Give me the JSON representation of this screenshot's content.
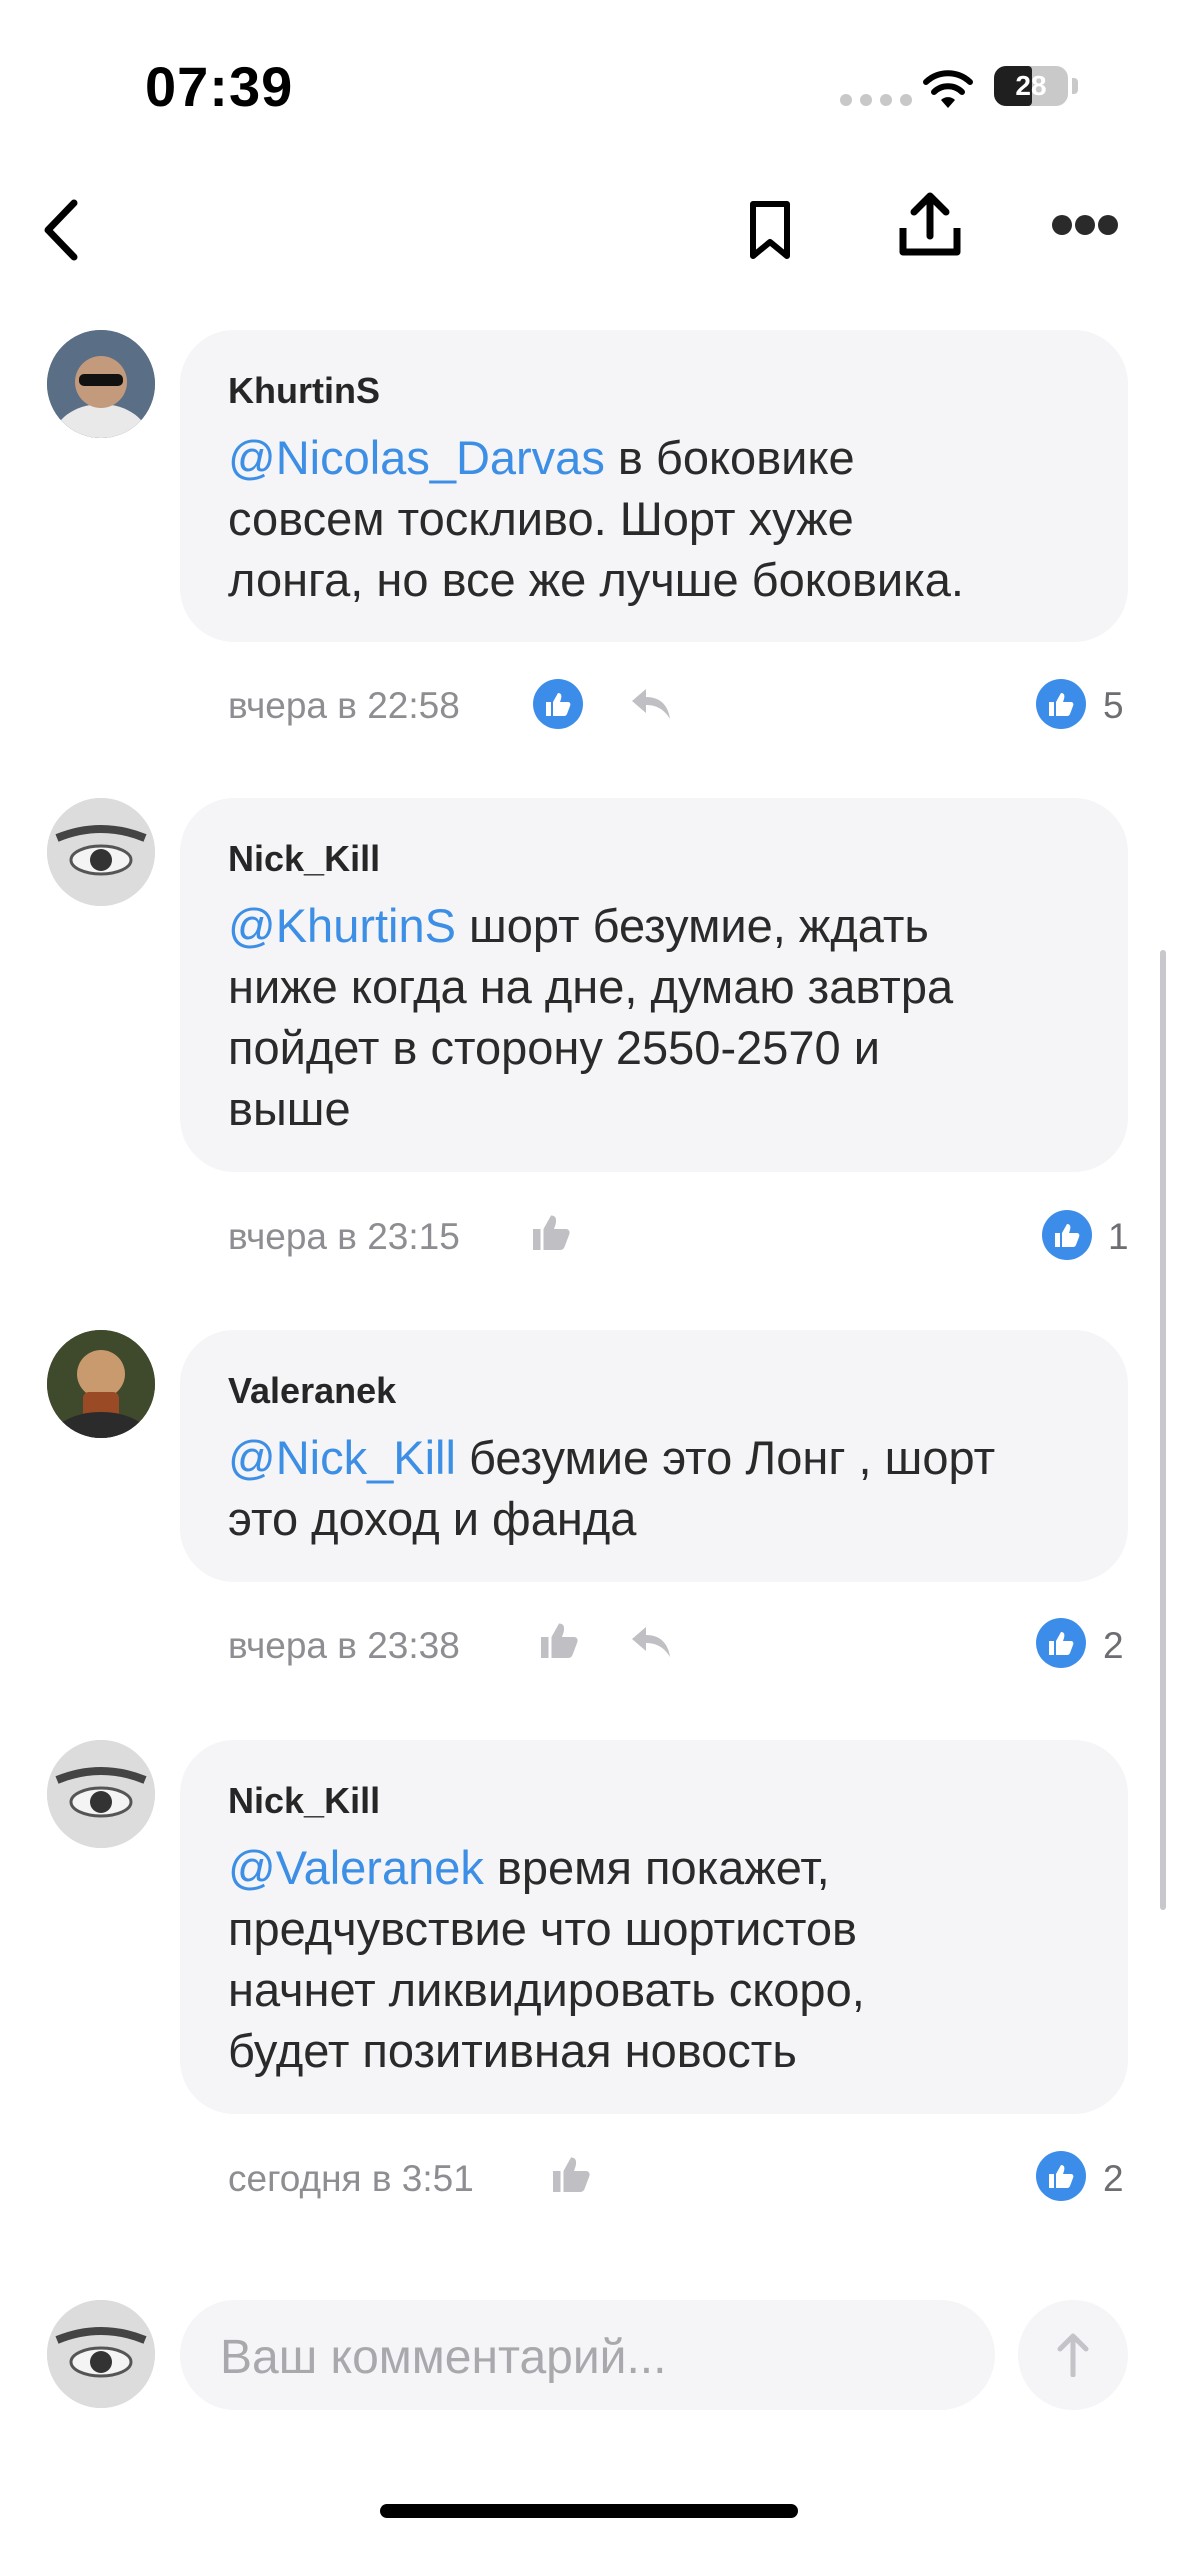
{
  "status_bar": {
    "time": "07:39",
    "battery": "28"
  },
  "nav": {
    "back_icon": "chevron-left-icon",
    "bookmark_icon": "bookmark-icon",
    "share_icon": "share-icon",
    "more_icon": "more-icon"
  },
  "comments": [
    {
      "author": "KhurtinS",
      "mention": "@Nicolas_Darvas",
      "text_lines": [
        " в боковике",
        "совсем тоскливо. Шорт хуже",
        "лонга, но все же лучше боковика."
      ],
      "time": "вчера в 22:58",
      "likes": "5",
      "avatar_color": "#6a7f95"
    },
    {
      "author": "Nick_Kill",
      "mention": "@KhurtinS",
      "text_lines": [
        " шорт безумие, ждать",
        "ниже когда на дне, думаю завтра",
        "пойдет в сторону 2550-2570 и",
        "выше"
      ],
      "time": "вчера в 23:15",
      "likes": "1",
      "avatar_color": "#d8d8d8"
    },
    {
      "author": "Valeranek",
      "mention": "@Nick_Kill",
      "text_lines": [
        " безумие это Лонг , шорт",
        "это доход и фанда"
      ],
      "time": "вчера в 23:38",
      "likes": "2",
      "avatar_color": "#4a3d2c"
    },
    {
      "author": "Nick_Kill",
      "mention": "@Valeranek",
      "text_lines": [
        " время покажет,",
        "предчувствие что шортистов",
        "начнет ликвидировать скоро,",
        "будет позитивная новость"
      ],
      "time": "сегодня в 3:51",
      "likes": "2",
      "avatar_color": "#d8d8d8"
    }
  ],
  "composer": {
    "placeholder": "Ваш комментарий..."
  },
  "colors": {
    "accent": "#3c8de9",
    "mention": "#3d8fe6",
    "bubble": "#f5f5f7",
    "meta": "#8d8d92"
  }
}
